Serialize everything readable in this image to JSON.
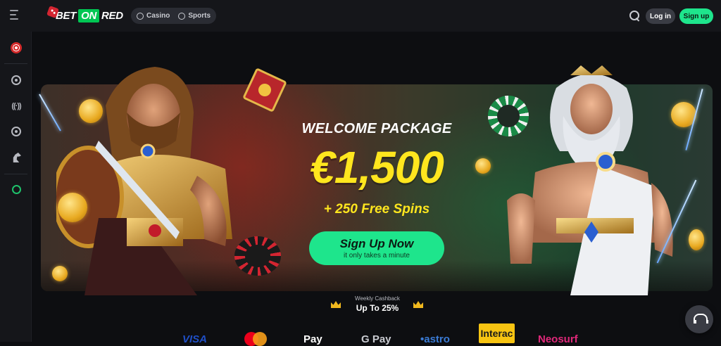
{
  "header": {
    "logo": {
      "bet": "BET",
      "on": "ON",
      "red": "RED"
    },
    "nav": [
      {
        "label": "Casino",
        "icon": "casino-chip-icon"
      },
      {
        "label": "Sports",
        "icon": "soccer-ball-icon"
      }
    ],
    "login_label": "Log in",
    "signup_label": "Sign up"
  },
  "sidebar": {
    "items": [
      {
        "name": "promotions",
        "icon": "target-icon"
      },
      {
        "name": "casino",
        "icon": "chip-icon"
      },
      {
        "name": "live",
        "icon": "live-signal-icon",
        "glyph": "((·))"
      },
      {
        "name": "sports",
        "icon": "soccer-ball-icon"
      },
      {
        "name": "racing",
        "icon": "horse-icon"
      },
      {
        "name": "bonus",
        "icon": "gift-icon"
      }
    ]
  },
  "hero": {
    "title": "WELCOME PACKAGE",
    "amount": "€1,500",
    "spins": "+ 250 Free Spins",
    "cta_label": "Sign Up Now",
    "cta_sub": "it only takes a minute"
  },
  "cashback": {
    "label": "Weekly Cashback",
    "value": "Up To 25%"
  },
  "payments": {
    "visa": "VISA",
    "apple_pay": " Pay",
    "google_pay": "G Pay",
    "astropay": "•astro",
    "interac": "Interac",
    "neosurf": "Neosurf"
  },
  "colors": {
    "accent_green": "#1ee58c",
    "promo_yellow": "#ffe61e",
    "brand_red": "#d32531",
    "background": "#0d0e11"
  }
}
